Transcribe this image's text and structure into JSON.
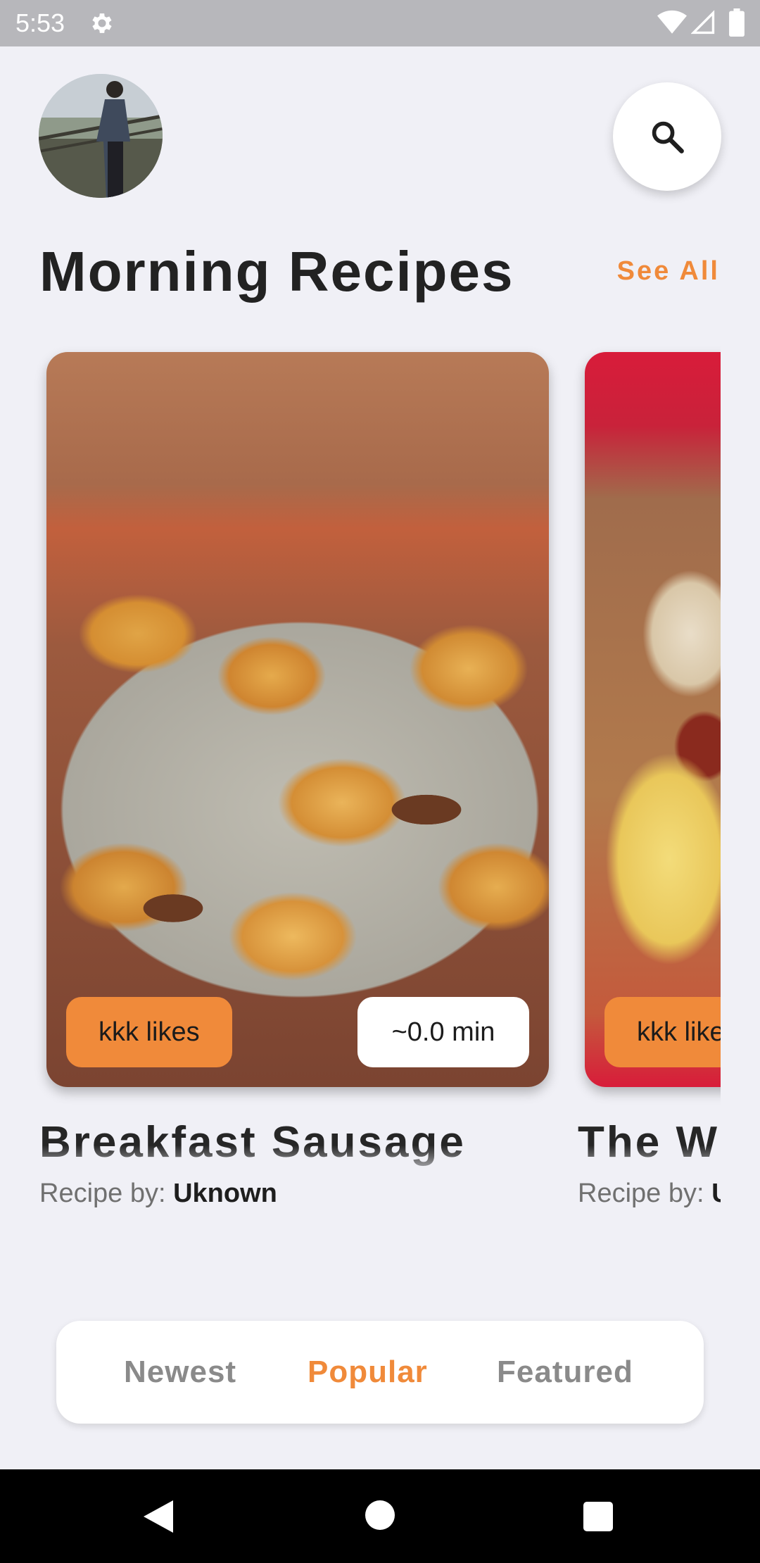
{
  "status_bar": {
    "time": "5:53",
    "icons": [
      "gear-icon",
      "wifi-icon",
      "signal-icon",
      "battery-icon"
    ]
  },
  "header": {
    "avatar_icon": "avatar-photo",
    "search_icon": "search-icon"
  },
  "section": {
    "title": "Morning Recipes",
    "see_all": "See All"
  },
  "cards": [
    {
      "likes": "kkk likes",
      "time": "~0.0 min",
      "title": "Breakfast Sausage",
      "author_prefix": "Recipe by: ",
      "author": "Uknown"
    },
    {
      "likes": "kkk likes",
      "title": "The Wr",
      "author_prefix": "Recipe by: ",
      "author": "U"
    }
  ],
  "tabs": [
    "Newest",
    "Popular",
    "Featured"
  ],
  "active_tab": "Popular",
  "colors": {
    "accent": "#f08a3a",
    "background": "#f0f0f6",
    "title": "#222222",
    "tab_inactive": "#8a8a8a"
  },
  "nav_bar": {
    "icons": [
      "back-icon",
      "home-icon",
      "recents-icon"
    ]
  }
}
